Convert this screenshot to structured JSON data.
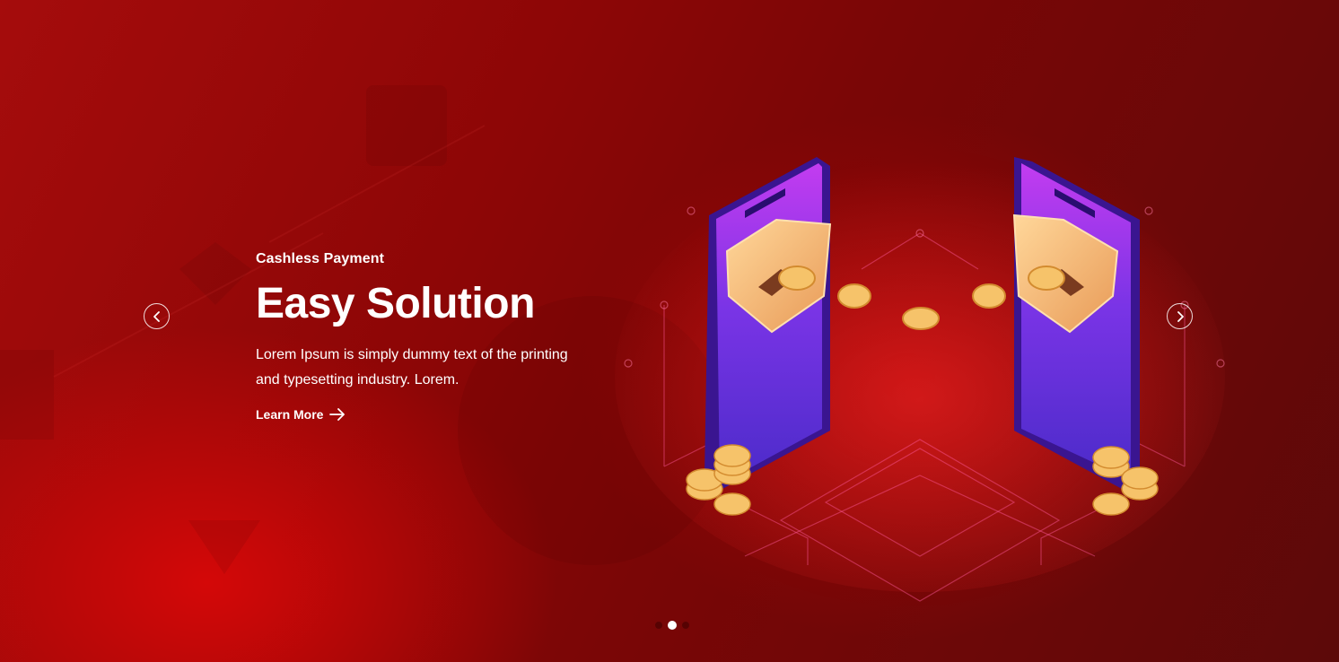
{
  "slide": {
    "eyebrow": "Cashless Payment",
    "title": "Easy Solution",
    "description": "Lorem Ipsum is simply dummy text of the printing and typesetting industry. Lorem.",
    "cta_label": "Learn More"
  },
  "carousel": {
    "prev_icon": "chevron-left-icon",
    "next_icon": "chevron-right-icon",
    "slide_count": 3,
    "active_index": 1
  },
  "colors": {
    "background_dark": "#5c0909",
    "background_bright": "#d40808",
    "phone": "#6a2ee0",
    "coin": "#f6c36a",
    "text": "#ffffff"
  }
}
